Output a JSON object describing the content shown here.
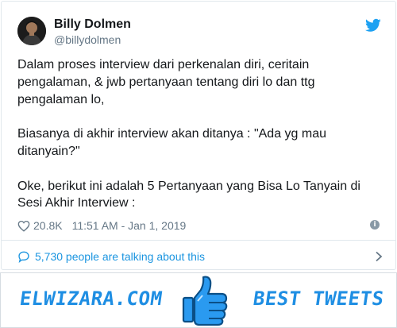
{
  "tweet": {
    "display_name": "Billy Dolmen",
    "handle": "@billydolmen",
    "paragraphs": [
      "Dalam proses interview dari perkenalan diri, ceritain pengalaman, & jwb pertanyaan tentang diri lo dan ttg pengalaman lo,",
      "Biasanya di akhir interview akan ditanya : \"Ada yg mau ditanyain?\"",
      "Oke, berikut ini adalah 5 Pertanyaan yang Bisa Lo Tanyain di Sesi Akhir Interview :"
    ],
    "like_count": "20.8K",
    "timestamp": "11:51 AM - Jan 1, 2019",
    "talking_text": "5,730 people are talking about this",
    "icons": {
      "avatar": "avatar",
      "bird": "twitter-bird-icon",
      "heart": "heart-icon",
      "info": "info-icon",
      "bubble": "speech-bubble-icon",
      "chevron": "chevron-right-icon"
    }
  },
  "banner": {
    "left_text": "ELWIZARA.COM",
    "right_text": "BEST TWEETS",
    "icon": "thumbs-up-icon"
  },
  "colors": {
    "twitter_blue": "#1da1f2",
    "link_blue": "#1b95e0",
    "muted_gray": "#657786",
    "banner_blue": "#1e8ee3"
  }
}
